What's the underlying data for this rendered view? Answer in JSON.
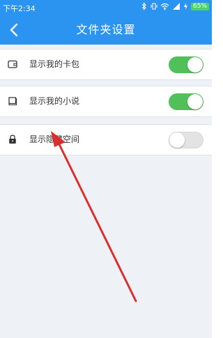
{
  "status_bar": {
    "time": "下午2:34",
    "battery": "65%",
    "icons": [
      "bluetooth-icon",
      "vibrate-icon",
      "wifi-icon",
      "signal-icon",
      "charging-icon",
      "battery-icon"
    ]
  },
  "header": {
    "title": "文件夹设置",
    "back_icon": "back-chevron-icon"
  },
  "settings": {
    "items": [
      {
        "label": "显示我的卡包",
        "icon": "wallet-icon",
        "enabled": true
      },
      {
        "label": "显示我的小说",
        "icon": "book-icon",
        "enabled": true
      },
      {
        "label": "显示隐藏空间",
        "icon": "lock-icon",
        "enabled": false
      }
    ]
  },
  "colors": {
    "header": "#2b94f0",
    "toggle_on": "#52c05a",
    "toggle_off": "#e3e3e3",
    "background": "#eef1f5",
    "annotation_arrow": "#d9302f"
  }
}
